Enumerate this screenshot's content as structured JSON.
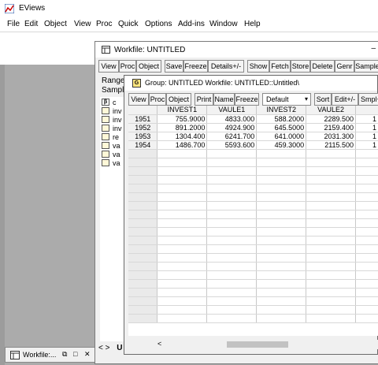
{
  "app": {
    "title": "EViews",
    "menu": [
      "File",
      "Edit",
      "Object",
      "View",
      "Proc",
      "Quick",
      "Options",
      "Add-ins",
      "Window",
      "Help"
    ]
  },
  "minimized": {
    "label": "Workfile:...",
    "controls": [
      "⧉",
      "□",
      "✕"
    ]
  },
  "workfile": {
    "title": "Workfile: UNTITLED",
    "title_controls": "–",
    "toolbar": [
      "View",
      "Proc",
      "Object",
      "Save",
      "Freeze",
      "Details+/-",
      "Show",
      "Fetch",
      "Store",
      "Delete",
      "Genr",
      "Sample"
    ],
    "range_label": "Range",
    "sample_label": "Sampl",
    "objects": [
      {
        "icon": "beta-icon",
        "name": "c"
      },
      {
        "icon": "series-icon",
        "name": "inv"
      },
      {
        "icon": "series-icon",
        "name": "inv"
      },
      {
        "icon": "series-icon",
        "name": "inv"
      },
      {
        "icon": "series-icon",
        "name": "re"
      },
      {
        "icon": "series-icon",
        "name": "va"
      },
      {
        "icon": "series-icon",
        "name": "va"
      },
      {
        "icon": "series-icon",
        "name": "va"
      }
    ],
    "bottom_nav": "< >",
    "bottom_tab": "U"
  },
  "group": {
    "icon_letter": "G",
    "title": "Group: UNTITLED   Workfile: UNTITLED::Untitled\\",
    "toolbar": [
      "View",
      "Proc",
      "Object",
      "Print",
      "Name",
      "Freeze",
      "Sort",
      "Edit+/-",
      "Smpl+/-"
    ],
    "dropdown_value": "Default",
    "columns": [
      "INVEST1",
      "VAULE1",
      "INVEST2",
      "VAULE2"
    ],
    "extra_col_cells": [
      "1",
      "1",
      "1",
      "1"
    ],
    "rows": [
      {
        "label": "1951",
        "values": [
          "755.9000",
          "4833.000",
          "588.2000",
          "2289.500"
        ]
      },
      {
        "label": "1952",
        "values": [
          "891.2000",
          "4924.900",
          "645.5000",
          "2159.400"
        ]
      },
      {
        "label": "1953",
        "values": [
          "1304.400",
          "6241.700",
          "641.0000",
          "2031.300"
        ]
      },
      {
        "label": "1954",
        "values": [
          "1486.700",
          "5593.600",
          "459.3000",
          "2115.500"
        ]
      }
    ],
    "empty_rows": 20,
    "scroll_left": "<"
  }
}
